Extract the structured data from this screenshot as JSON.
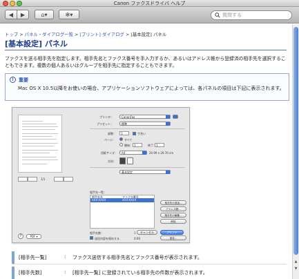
{
  "window": {
    "title": "Canon ファクスドライバ ヘルプ"
  },
  "toolbar": {
    "back_icon": "◀",
    "forward_icon": "▶",
    "home_icon": "⌂▾",
    "action_icon": "✻▾",
    "search_placeholder": "質問する"
  },
  "breadcrumb": {
    "items": [
      "トップ",
      "パネル・ダイアログ一覧",
      "[プリント] ダイアログ",
      "[基本設定] パネル"
    ],
    "separator": ">"
  },
  "page": {
    "title": "[基本設定] パネル",
    "intro": "ファクスを送る相手先を指定します。相手先名とファクス番号を手入力するか、あるいはアドレス帳から登録済の相手先を選択することもできます。複数の個人あるいはグループを相手先に指定することもできます。"
  },
  "note": {
    "icon": "!",
    "title": "重要",
    "text": "Mac OS X 10.5以降をお使いの場合、アプリケーションソフトウェアによっては、各パネルの項目は下記に表示されます。"
  },
  "dialog": {
    "printer_label": "プリンタ：",
    "printer_value": "CanonFax",
    "preset_label": "プリセット：",
    "preset_value": "標準",
    "copies_label": "部数：",
    "copies_value": "1",
    "collate_label": "丁合い",
    "pages_label": "ページ：",
    "pages_all": "すべて",
    "pages_from": "開始：",
    "pages_to": "終了：",
    "from_value": "1",
    "to_value": "1",
    "paper_label": "用紙サイズ：",
    "paper_value": "A4",
    "paper_dims": "20.99 x 29.70 cm",
    "orientation_label": "方向：",
    "panel_value": "基本設定",
    "list_title": "相手先一覧：",
    "col_name": "相手先名",
    "col_fax": "ファクス番号",
    "row_name": "XXX-XXXX",
    "row_fax": "XXX-XXXX",
    "btn_add": "相手先の追加...",
    "btn_addressbook": "アドレス帳...",
    "btn_edit": "相手先の編集...",
    "btn_delete": "削除",
    "count_label": "相手先数：",
    "count_value": "1",
    "save_label": "送信内容を保存する",
    "time_value": "0:00",
    "settings_btn": "設定...",
    "pdf_btn": "PDF ▾",
    "help_btn": "?",
    "cancel_btn": "キャンセル",
    "print_btn": "プリント",
    "page_nav": "1/1"
  },
  "descriptions": [
    {
      "term": "[相手先一覧]",
      "text": "ファクス送信する相手先名とファクス番号が表示されます。"
    },
    {
      "term": "[相手先数]",
      "text": "[相手先一覧] に登録されている相手先の件数が表示されます。"
    }
  ],
  "scrollbar": {
    "up_icon": "▲",
    "down_icon": "▼"
  }
}
